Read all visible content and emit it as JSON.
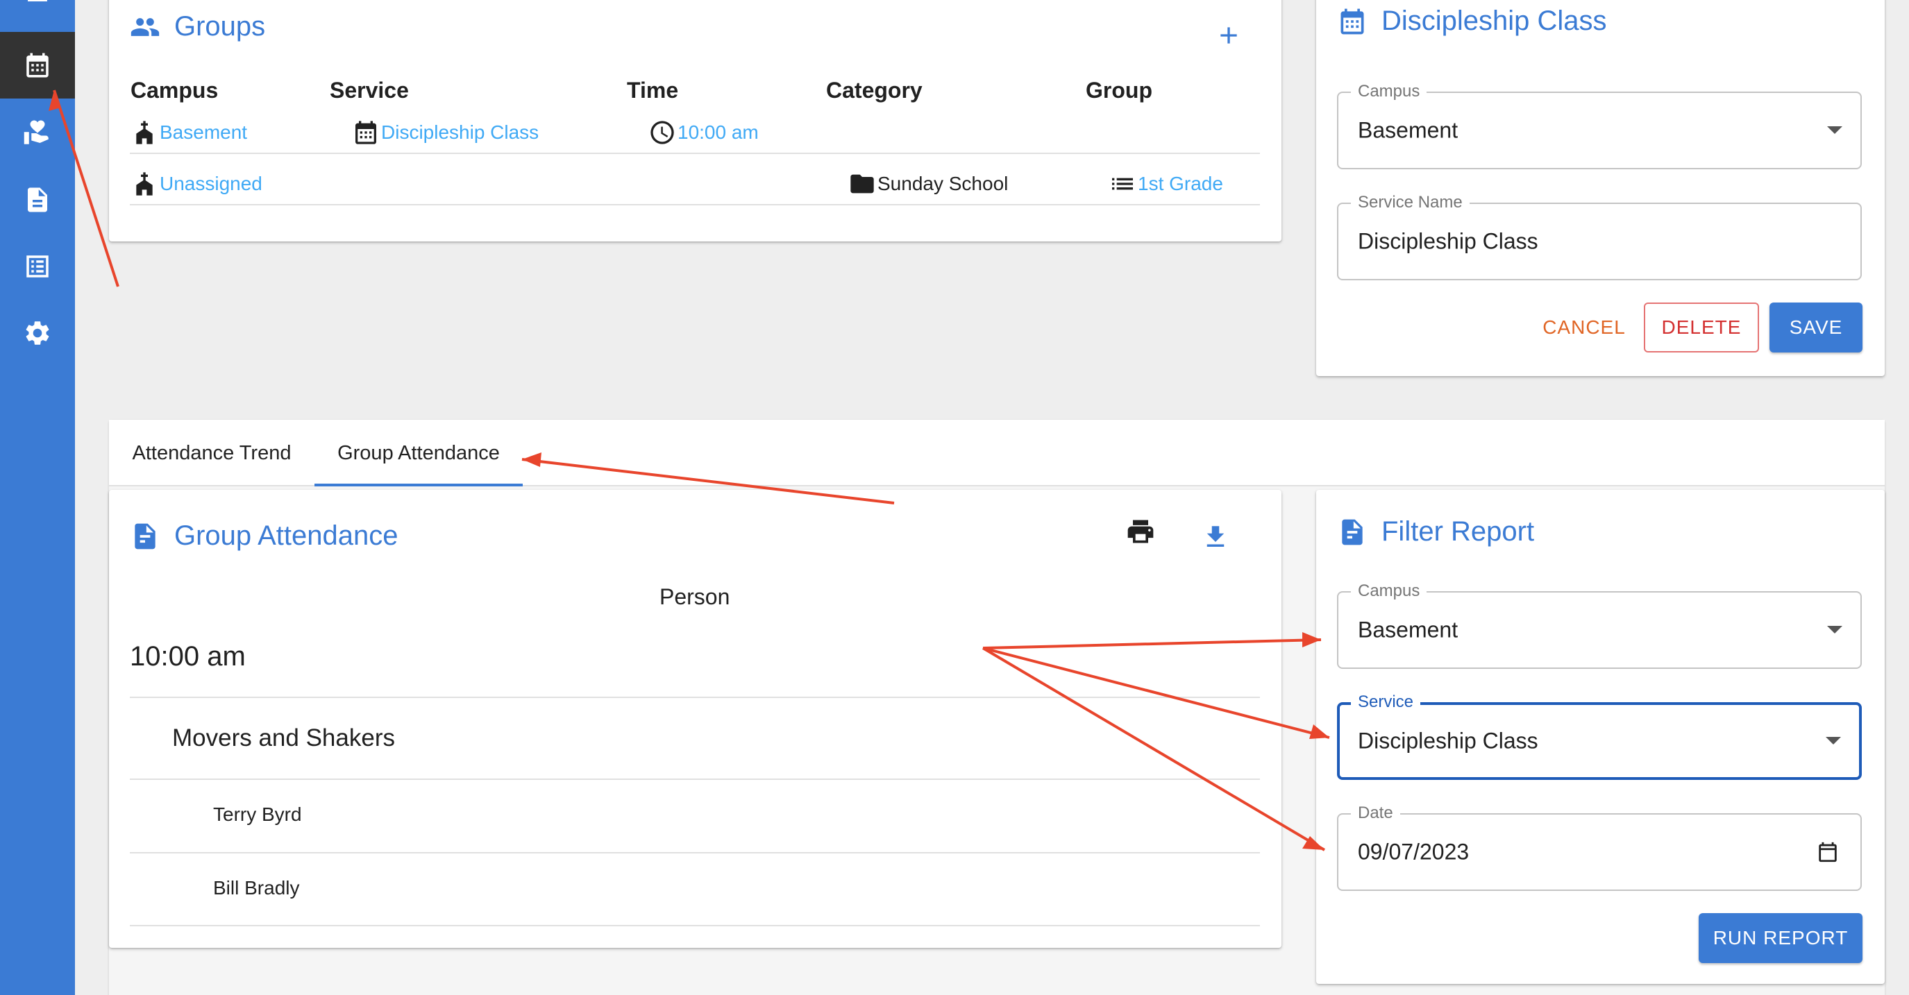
{
  "groups_card": {
    "title": "Groups",
    "add_icon": "plus-icon",
    "columns": [
      "Campus",
      "Service",
      "Time",
      "Category",
      "Group"
    ],
    "rows": [
      {
        "campus": "Basement",
        "service": "Discipleship Class",
        "time": "10:00 am",
        "category": "",
        "group": ""
      },
      {
        "campus": "Unassigned",
        "service": "",
        "time": "",
        "category": "Sunday School",
        "group": "1st Grade"
      }
    ]
  },
  "service_card": {
    "title": "Discipleship Class",
    "campus_label": "Campus",
    "campus_value": "Basement",
    "service_name_label": "Service Name",
    "service_name_value": "Discipleship Class",
    "cancel_label": "CANCEL",
    "delete_label": "DELETE",
    "save_label": "SAVE"
  },
  "tabs": [
    {
      "label": "Attendance Trend",
      "active": false
    },
    {
      "label": "Group Attendance",
      "active": true
    }
  ],
  "report": {
    "title": "Group Attendance",
    "column_header": "Person",
    "time_heading": "10:00 am",
    "group_heading": "Movers and Shakers",
    "people": [
      "Terry Byrd",
      "Bill Bradly"
    ]
  },
  "filter": {
    "title": "Filter Report",
    "campus_label": "Campus",
    "campus_value": "Basement",
    "service_label": "Service",
    "service_value": "Discipleship Class",
    "date_label": "Date",
    "date_value": "09/07/2023",
    "run_label": "RUN REPORT"
  },
  "colors": {
    "sidebar": "#3b7bd4",
    "accent": "#3b7bd4",
    "link": "#3fa9f5",
    "annotation_arrow": "#e8452c",
    "delete": "#d32f2f",
    "cancel": "#e06525"
  }
}
